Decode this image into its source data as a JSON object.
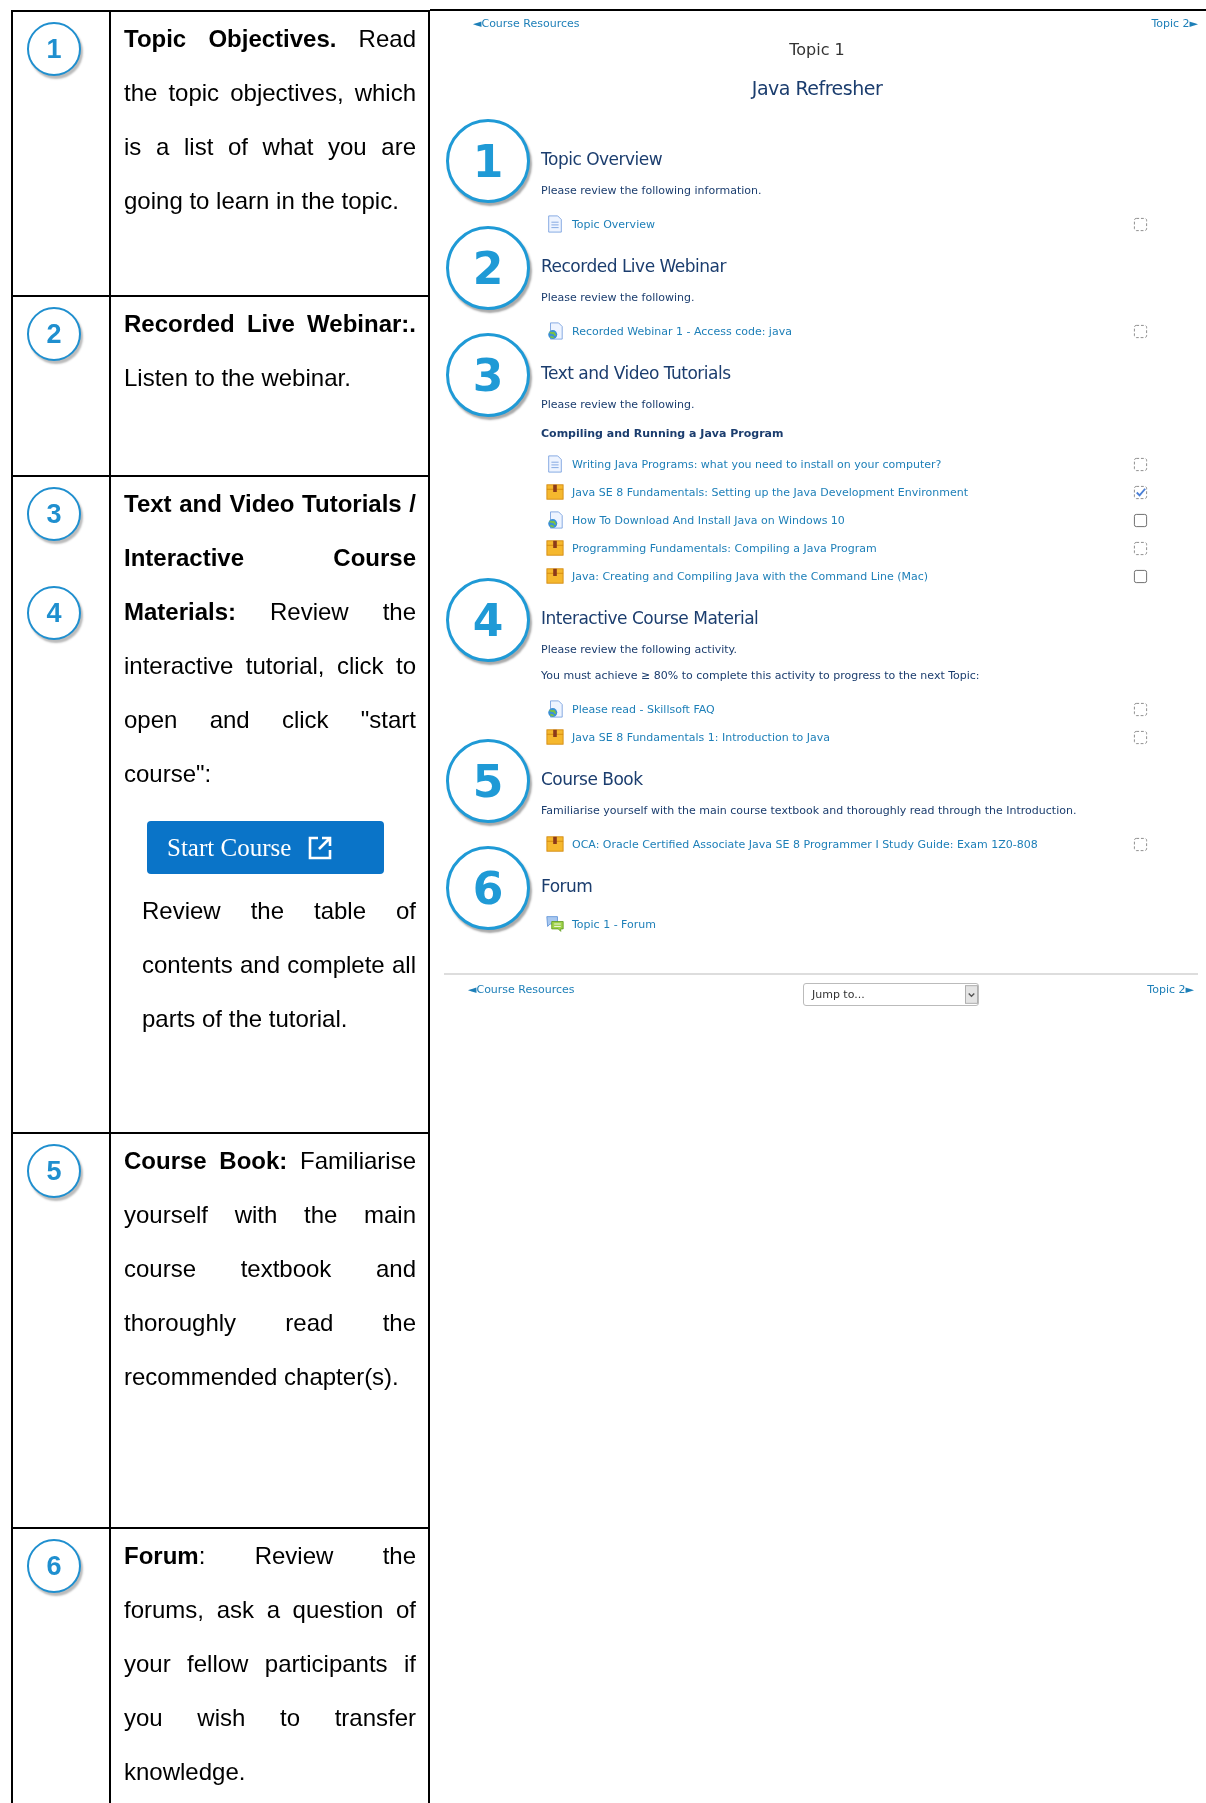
{
  "left_table": {
    "rows": [
      {
        "badges": [
          "1"
        ],
        "blocks": [
          {
            "kind": "text",
            "text": "**Topic Objectives.** Read the topic objectives, which is a list of what you are going to learn in the topic."
          }
        ]
      },
      {
        "badges": [
          "2"
        ],
        "blocks": [
          {
            "kind": "text",
            "text": "**Recorded Live Webinar:.** Listen to the webinar."
          }
        ]
      },
      {
        "badges": [
          "3",
          "4"
        ],
        "blocks": [
          {
            "kind": "text",
            "text": "**Text and Video Tutorials / Interactive Course Materials:** Review the interactive tutorial, click to open and click \"start course\":"
          },
          {
            "kind": "button",
            "text": "Start Course"
          },
          {
            "kind": "indented",
            "text": "Review the table of contents and complete all parts of the tutorial."
          }
        ]
      },
      {
        "badges": [
          "5"
        ],
        "blocks": [
          {
            "kind": "text",
            "text": "**Course Book:** Familiarise yourself with the main course textbook and thoroughly read the recommended chapter(s)."
          }
        ]
      },
      {
        "badges": [
          "6"
        ],
        "blocks": [
          {
            "kind": "text",
            "text": "**Forum**: Review the forums, ask a question of your fellow participants if you wish to transfer knowledge."
          }
        ]
      }
    ]
  },
  "course_page": {
    "nav_top": {
      "prev": "◄Course Resources",
      "next": "Topic 2►"
    },
    "topic": "Topic 1",
    "title": "Java Refresher",
    "sections": [
      {
        "badge": "1",
        "heading": "Topic Overview",
        "texts": [
          {
            "kind": "text",
            "text": "Please review the following information."
          }
        ],
        "items": [
          {
            "kind": "page",
            "label": "Topic Overview",
            "manual": false,
            "checked": false
          }
        ]
      },
      {
        "badge": "2",
        "heading": "Recorded Live Webinar",
        "texts": [
          {
            "kind": "text",
            "text": "Please review the following."
          }
        ],
        "items": [
          {
            "kind": "url",
            "label": "Recorded Webinar 1 - Access code: java",
            "manual": false,
            "checked": false
          }
        ]
      },
      {
        "badge": "3",
        "heading": "Text and Video Tutorials",
        "texts": [
          {
            "kind": "text",
            "text": "Please review the following."
          },
          {
            "kind": "subheading",
            "text": "Compiling and Running a Java Program"
          }
        ],
        "items": [
          {
            "kind": "page",
            "label": "Writing Java Programs: what you need to install on your computer?",
            "manual": false,
            "checked": false
          },
          {
            "kind": "package",
            "label": "Java SE 8 Fundamentals: Setting up the Java Development Environment",
            "manual": false,
            "checked": true
          },
          {
            "kind": "url",
            "label": "How To Download And Install Java on Windows 10",
            "manual": true,
            "checked": false
          },
          {
            "kind": "package",
            "label": "Programming Fundamentals: Compiling a Java Program",
            "manual": false,
            "checked": false
          },
          {
            "kind": "package",
            "label": "Java: Creating and Compiling Java with the Command Line (Mac)",
            "manual": true,
            "checked": false
          }
        ]
      },
      {
        "badge": "4",
        "heading": "Interactive Course Material",
        "texts": [
          {
            "kind": "text",
            "text": "Please review the following activity."
          },
          {
            "kind": "text",
            "text": "You must achieve ≥ 80% to complete this activity to progress to the next Topic:"
          }
        ],
        "items": [
          {
            "kind": "url",
            "label": "Please read - Skillsoft FAQ",
            "manual": false,
            "checked": false
          },
          {
            "kind": "package",
            "label": "Java SE 8 Fundamentals 1: Introduction to Java",
            "manual": false,
            "checked": false
          }
        ]
      },
      {
        "badge": "5",
        "heading": "Course Book",
        "texts": [
          {
            "kind": "text",
            "text": "Familiarise yourself with the main course textbook and thoroughly read through the Introduction."
          }
        ],
        "items": [
          {
            "kind": "package",
            "label": "OCA: Oracle Certified Associate Java SE 8 Programmer I Study Guide: Exam 1Z0-808",
            "manual": false,
            "checked": false
          }
        ]
      },
      {
        "badge": "6",
        "heading": "Forum",
        "items": [
          {
            "kind": "forum",
            "label": "Topic 1 - Forum"
          }
        ]
      }
    ],
    "nav_bottom": {
      "prev": "◄Course Resources",
      "jump": "Jump to...",
      "next": "Topic 2►"
    }
  }
}
